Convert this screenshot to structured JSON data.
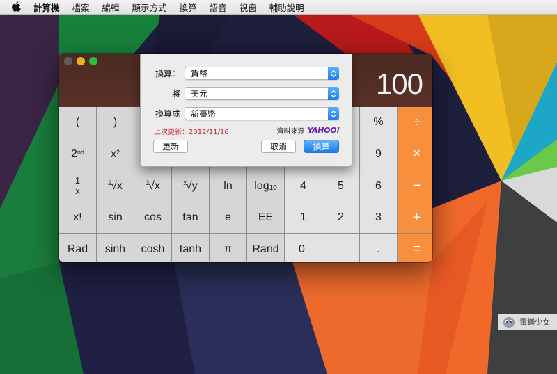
{
  "menubar": {
    "apple_icon": "apple-icon",
    "items": [
      "計算機",
      "檔案",
      "編輯",
      "顯示方式",
      "換算",
      "語音",
      "視窗",
      "輔助說明"
    ]
  },
  "calculator": {
    "display_value": "100",
    "keys": [
      [
        "(",
        ")",
        "",
        "",
        "",
        "",
        "",
        "",
        "%",
        "÷"
      ],
      [
        "2nd",
        "x2",
        "",
        "",
        "",
        "",
        "",
        "",
        "9",
        "×"
      ],
      [
        "1/x",
        "2√x",
        "3√x",
        "x√y",
        "ln",
        "log10",
        "4",
        "5",
        "6",
        "−"
      ],
      [
        "x!",
        "sin",
        "cos",
        "tan",
        "e",
        "EE",
        "1",
        "2",
        "3",
        "+"
      ],
      [
        "Rad",
        "sinh",
        "cosh",
        "tanh",
        "π",
        "Rand",
        "0",
        ".",
        "="
      ]
    ]
  },
  "conversion": {
    "convert_label": "換算：",
    "convert_value": "貨幣",
    "from_label": "將",
    "from_value": "美元",
    "to_label": "換算成",
    "to_value": "新臺幣",
    "last_updated": "上次更新：2012/11/16",
    "source_label": "資料來源",
    "source_logo": "YAHOO!",
    "update_button": "更新",
    "cancel_button": "取消",
    "convert_button": "換算"
  },
  "watermark": {
    "text": "電獺少女"
  },
  "colors": {
    "operator_orange": "#f78f3c",
    "display_background": "#4a2a22",
    "primary_button_blue": "#1b7bef",
    "update_text_red": "#d02020",
    "yahoo_purple": "#6b1fb3"
  }
}
